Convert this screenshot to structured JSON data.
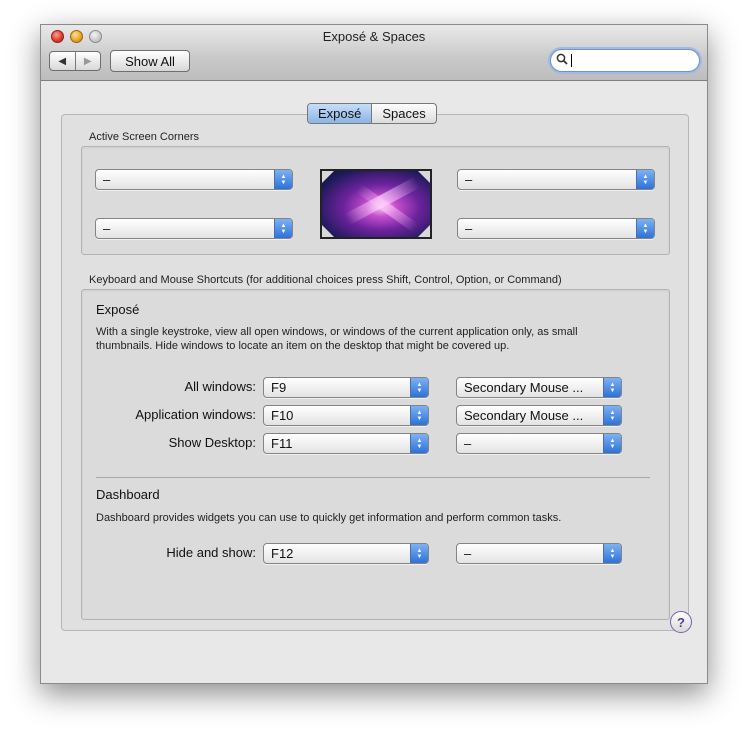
{
  "window": {
    "title": "Exposé & Spaces",
    "show_all_label": "Show All",
    "nav_back_glyph": "◀",
    "nav_forward_glyph": "▶",
    "search": {
      "value": "",
      "icon": "search-icon"
    }
  },
  "tabs": [
    {
      "label": "Exposé",
      "selected": true
    },
    {
      "label": "Spaces",
      "selected": false
    }
  ],
  "active_screen_corners": {
    "label": "Active Screen Corners",
    "top_left": "–",
    "bottom_left": "–",
    "top_right": "–",
    "bottom_right": "–"
  },
  "shortcuts": {
    "label": "Keyboard and Mouse Shortcuts (for additional choices press Shift, Control, Option, or Command)",
    "expose": {
      "title": "Exposé",
      "description_line1": "With a single keystroke, view all open windows, or windows of the current application only, as small",
      "description_line2": "thumbnails. Hide windows to locate an item on the desktop that might be covered up.",
      "rows": [
        {
          "label": "All windows:",
          "key": "F9",
          "mouse": "Secondary Mouse ..."
        },
        {
          "label": "Application windows:",
          "key": "F10",
          "mouse": "Secondary Mouse ..."
        },
        {
          "label": "Show Desktop:",
          "key": "F11",
          "mouse": "–"
        }
      ]
    },
    "dashboard": {
      "title": "Dashboard",
      "description": "Dashboard provides widgets you can use to quickly get information and perform common tasks.",
      "rows": [
        {
          "label": "Hide and show:",
          "key": "F12",
          "mouse": "–"
        }
      ]
    }
  },
  "help_glyph": "?",
  "colors": {
    "accent": "#3d7ee0",
    "tab_selected": "#a9c9f0",
    "window_bg": "#e8e8e8"
  }
}
